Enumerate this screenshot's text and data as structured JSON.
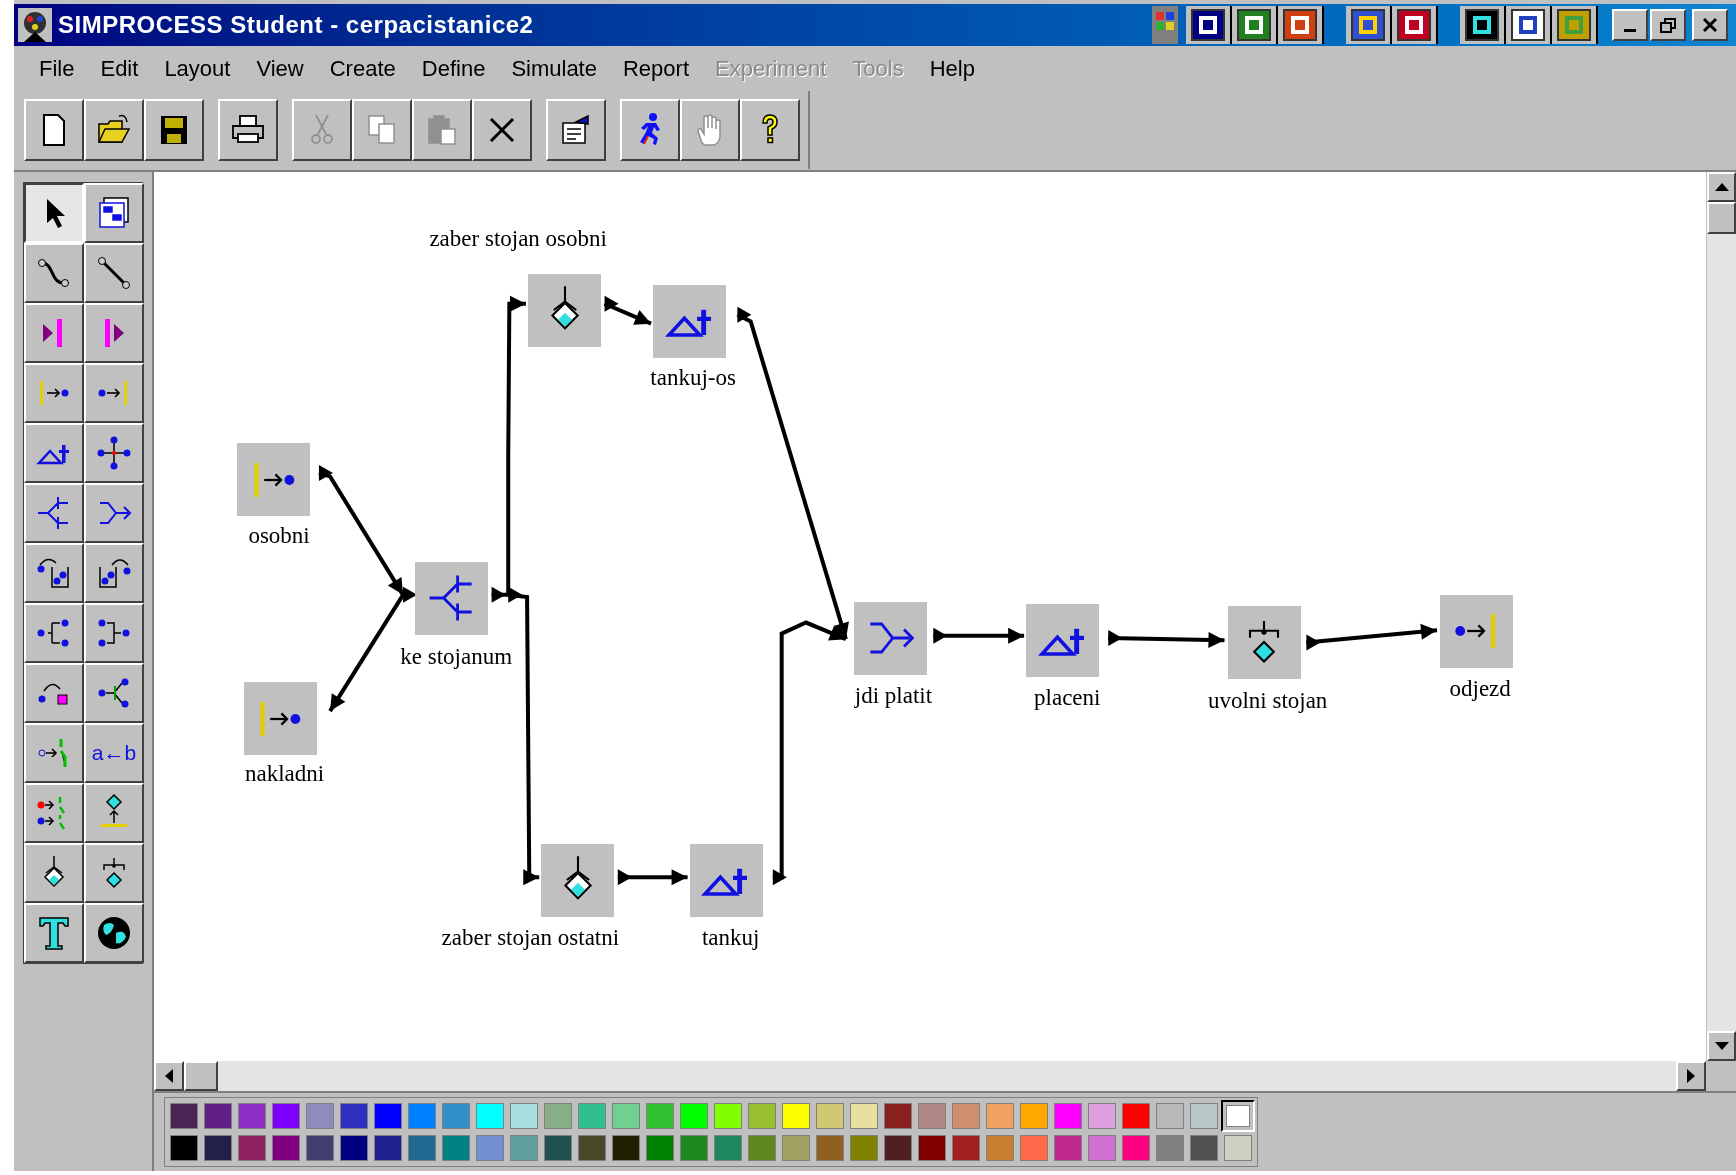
{
  "window": {
    "title": "SIMPROCESS Student - cerpacistanice2"
  },
  "menu": [
    {
      "label": "File",
      "disabled": false
    },
    {
      "label": "Edit",
      "disabled": false
    },
    {
      "label": "Layout",
      "disabled": false
    },
    {
      "label": "View",
      "disabled": false
    },
    {
      "label": "Create",
      "disabled": false
    },
    {
      "label": "Define",
      "disabled": false
    },
    {
      "label": "Simulate",
      "disabled": false
    },
    {
      "label": "Report",
      "disabled": false
    },
    {
      "label": "Experiment",
      "disabled": true
    },
    {
      "label": "Tools",
      "disabled": true
    },
    {
      "label": "Help",
      "disabled": false
    }
  ],
  "toolbar": [
    {
      "kind": "new",
      "disabled": false
    },
    {
      "kind": "open",
      "disabled": false
    },
    {
      "kind": "save",
      "disabled": false
    },
    {
      "kind": "print",
      "disabled": false
    },
    {
      "kind": "cut",
      "disabled": true
    },
    {
      "kind": "copy",
      "disabled": true
    },
    {
      "kind": "paste",
      "disabled": true
    },
    {
      "kind": "delete",
      "disabled": false
    },
    {
      "kind": "properties",
      "disabled": false
    },
    {
      "kind": "run",
      "disabled": false
    },
    {
      "kind": "hand",
      "disabled": true
    },
    {
      "kind": "help",
      "disabled": false
    }
  ],
  "palette": [
    {
      "kind": "pointer",
      "selected": true
    },
    {
      "kind": "hierarchy",
      "selected": false
    },
    {
      "kind": "curved-connector",
      "selected": false
    },
    {
      "kind": "straight-connector",
      "selected": false
    },
    {
      "kind": "entry-port",
      "selected": false
    },
    {
      "kind": "exit-port",
      "selected": false
    },
    {
      "kind": "start",
      "selected": false
    },
    {
      "kind": "end",
      "selected": false
    },
    {
      "kind": "delay",
      "selected": false
    },
    {
      "kind": "assign",
      "selected": false
    },
    {
      "kind": "branch",
      "selected": false
    },
    {
      "kind": "merge",
      "selected": false
    },
    {
      "kind": "batch",
      "selected": false
    },
    {
      "kind": "unbatch",
      "selected": false
    },
    {
      "kind": "split",
      "selected": false
    },
    {
      "kind": "join",
      "selected": false
    },
    {
      "kind": "transform",
      "selected": false
    },
    {
      "kind": "replicate",
      "selected": false
    },
    {
      "kind": "gate",
      "selected": false
    },
    {
      "kind": "label",
      "label": "a←b",
      "selected": false
    },
    {
      "kind": "synchronize",
      "selected": false
    },
    {
      "kind": "trigger",
      "selected": false
    },
    {
      "kind": "get-resource",
      "selected": false
    },
    {
      "kind": "free-resource",
      "selected": false
    },
    {
      "kind": "text",
      "selected": false
    },
    {
      "kind": "globe",
      "selected": false
    }
  ],
  "diagram": {
    "nodes": [
      {
        "label": "zaber stojan osobni",
        "kind": "get-resource"
      },
      {
        "label": "tankuj-os",
        "kind": "delay"
      },
      {
        "label": "osobni",
        "kind": "start"
      },
      {
        "label": "ke stojanum",
        "kind": "branch"
      },
      {
        "label": "jdi platit",
        "kind": "merge"
      },
      {
        "label": "placeni",
        "kind": "delay"
      },
      {
        "label": "uvolni stojan",
        "kind": "free-resource"
      },
      {
        "label": "odjezd",
        "kind": "end"
      },
      {
        "label": "nakladni",
        "kind": "start"
      },
      {
        "label": "zaber stojan ostatni",
        "kind": "get-resource"
      },
      {
        "label": "tankuj",
        "kind": "delay"
      }
    ]
  },
  "colors": [
    {
      "color": "#4b2553",
      "selected": false
    },
    {
      "color": "#5f1f87",
      "selected": false
    },
    {
      "color": "#8e30c6",
      "selected": false
    },
    {
      "color": "#8000ff",
      "selected": false
    },
    {
      "color": "#8c8cc0",
      "selected": false
    },
    {
      "color": "#3030c0",
      "selected": false
    },
    {
      "color": "#0000ff",
      "selected": false
    },
    {
      "color": "#0080ff",
      "selected": false
    },
    {
      "color": "#3090c8",
      "selected": false
    },
    {
      "color": "#00ffff",
      "selected": false
    },
    {
      "color": "#a8e0e0",
      "selected": false
    },
    {
      "color": "#88b088",
      "selected": false
    },
    {
      "color": "#30c090",
      "selected": false
    },
    {
      "color": "#70d090",
      "selected": false
    },
    {
      "color": "#30c030",
      "selected": false
    },
    {
      "color": "#00ff00",
      "selected": false
    },
    {
      "color": "#80ff00",
      "selected": false
    },
    {
      "color": "#98c030",
      "selected": false
    },
    {
      "color": "#ffff00",
      "selected": false
    },
    {
      "color": "#d0c870",
      "selected": false
    },
    {
      "color": "#e8e0a0",
      "selected": false
    },
    {
      "color": "#882020",
      "selected": false
    },
    {
      "color": "#b08888",
      "selected": false
    },
    {
      "color": "#d09070",
      "selected": false
    },
    {
      "color": "#f0a060",
      "selected": false
    },
    {
      "color": "#ffa800",
      "selected": false
    },
    {
      "color": "#ff00ff",
      "selected": false
    },
    {
      "color": "#e0a0e0",
      "selected": false
    },
    {
      "color": "#ff0000",
      "selected": false
    },
    {
      "color": "#b8b8b8",
      "selected": false
    },
    {
      "color": "#b8c8c8",
      "selected": false
    },
    {
      "color": "#ffffff",
      "selected": true
    },
    {
      "color": "#000000",
      "selected": false
    },
    {
      "color": "#202048",
      "selected": false
    },
    {
      "color": "#902060",
      "selected": false
    },
    {
      "color": "#800080",
      "selected": false
    },
    {
      "color": "#404070",
      "selected": false
    },
    {
      "color": "#000080",
      "selected": false
    },
    {
      "color": "#202090",
      "selected": false
    },
    {
      "color": "#206890",
      "selected": false
    },
    {
      "color": "#008080",
      "selected": false
    },
    {
      "color": "#7090d0",
      "selected": false
    },
    {
      "color": "#60a0a0",
      "selected": false
    },
    {
      "color": "#205050",
      "selected": false
    },
    {
      "color": "#484828",
      "selected": false
    },
    {
      "color": "#202000",
      "selected": false
    },
    {
      "color": "#008000",
      "selected": false
    },
    {
      "color": "#208820",
      "selected": false
    },
    {
      "color": "#208860",
      "selected": false
    },
    {
      "color": "#608820",
      "selected": false
    },
    {
      "color": "#a0a060",
      "selected": false
    },
    {
      "color": "#906020",
      "selected": false
    },
    {
      "color": "#808000",
      "selected": false
    },
    {
      "color": "#502020",
      "selected": false
    },
    {
      "color": "#800000",
      "selected": false
    },
    {
      "color": "#a02020",
      "selected": false
    },
    {
      "color": "#c88030",
      "selected": false
    },
    {
      "color": "#ff6848",
      "selected": false
    },
    {
      "color": "#c02890",
      "selected": false
    },
    {
      "color": "#d070d0",
      "selected": false
    },
    {
      "color": "#ff0080",
      "selected": false
    },
    {
      "color": "#808080",
      "selected": false
    },
    {
      "color": "#505050",
      "selected": false
    },
    {
      "color": "#d0d0c0",
      "selected": false
    }
  ]
}
